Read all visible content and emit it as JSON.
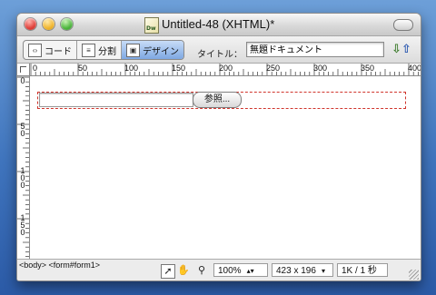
{
  "window": {
    "title": "Untitled-48 (XHTML)*",
    "doc_icon_label": "Dw"
  },
  "toolbar": {
    "code_label": "コード",
    "split_label": "分割",
    "design_label": "デザイン",
    "title_label": "タイトル：",
    "title_value": "無題ドキュメント"
  },
  "ruler": {
    "h_labels": [
      "0",
      "50",
      "100",
      "150",
      "200",
      "250",
      "300",
      "350",
      "400"
    ],
    "v_labels": [
      "0",
      "50",
      "100",
      "150"
    ]
  },
  "form": {
    "browse_label": "参照..."
  },
  "status": {
    "tag_selector": "<body> <form#form1>",
    "zoom": "100%",
    "window_size": "423 x 196",
    "download_stat": "1K / 1 秒"
  },
  "colors": {
    "desktop": "#3f74bd",
    "form_outline": "#d0342c",
    "active_segment": "#7ea8e3"
  }
}
